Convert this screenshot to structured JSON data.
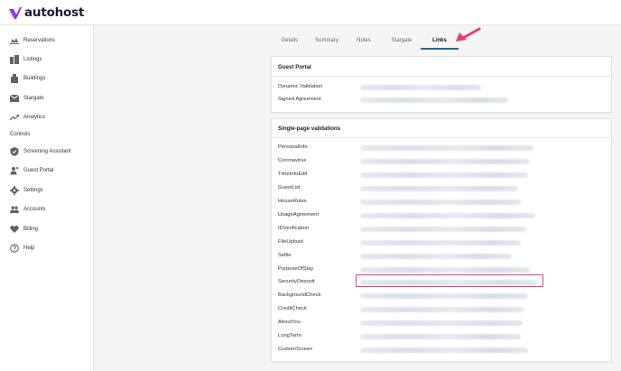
{
  "app": {
    "name": "autohost",
    "brand_color": "#7a3cf0",
    "accent_color": "#e0417a",
    "tab_active_color": "#1e6b93"
  },
  "sidebar": {
    "items": [
      {
        "label": "Reservations",
        "icon": "airplane-icon"
      },
      {
        "label": "Listings",
        "icon": "listings-icon"
      },
      {
        "label": "Buildings",
        "icon": "building-icon"
      },
      {
        "label": "Stargate",
        "icon": "mail-icon"
      },
      {
        "label": "Analytics",
        "icon": "trending-up-icon"
      }
    ],
    "section_label": "Controls",
    "controls": [
      {
        "label": "Screening Assistant",
        "icon": "shield-check-icon"
      },
      {
        "label": "Guest Portal",
        "icon": "person-key-icon"
      },
      {
        "label": "Settings",
        "icon": "gear-icon"
      },
      {
        "label": "Accounts",
        "icon": "people-icon"
      },
      {
        "label": "Billing",
        "icon": "heart-icon"
      },
      {
        "label": "Help",
        "icon": "help-circle-icon"
      }
    ]
  },
  "tabs": [
    {
      "label": "Details"
    },
    {
      "label": "Summary"
    },
    {
      "label": "Notes"
    },
    {
      "label": "Stargate"
    },
    {
      "label": "Links",
      "active": true
    }
  ],
  "guest_portal": {
    "title": "Guest Portal",
    "rows": [
      {
        "label": "Dynamic Validation"
      },
      {
        "label": "Signed Agreement"
      }
    ]
  },
  "single_page": {
    "title": "Single-page validations",
    "rows": [
      {
        "label": "PersonalInfo"
      },
      {
        "label": "Coronavirus"
      },
      {
        "label": "TimeInfoEdit"
      },
      {
        "label": "GuestList"
      },
      {
        "label": "HouseRules"
      },
      {
        "label": "UsageAgreement"
      },
      {
        "label": "IDVerification"
      },
      {
        "label": "FileUpload"
      },
      {
        "label": "Selfie"
      },
      {
        "label": "PurposeOfStay"
      },
      {
        "label": "SecurityDeposit",
        "highlighted": true
      },
      {
        "label": "BackgroundCheck"
      },
      {
        "label": "CreditCheck"
      },
      {
        "label": "AboutYou"
      },
      {
        "label": "LongTerm"
      },
      {
        "label": "CustomScreen"
      }
    ]
  }
}
